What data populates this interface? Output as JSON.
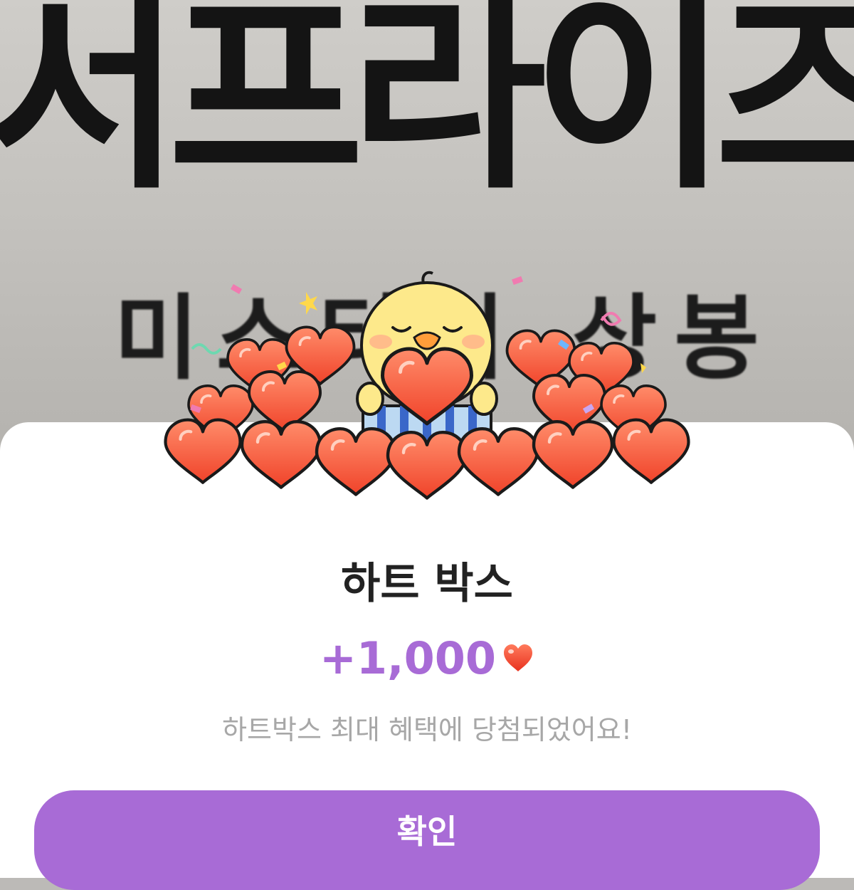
{
  "background": {
    "sign_large_text": "서프라이즈",
    "sign_small_text": "미스터리 상봉"
  },
  "colors": {
    "accent": "#a86bd6",
    "heart_red": "#f25a3c",
    "sheet": "#ffffff",
    "title": "#222222",
    "subtitle": "#a7a7a7"
  },
  "illustration": {
    "icon": "chick-holding-heart-box-icon"
  },
  "popup": {
    "title": "하트 박스",
    "amount": "+1,000",
    "amount_icon": "heart-icon",
    "message": "하트박스 최대 혜택에 당첨되었어요!",
    "confirm_label": "확인"
  }
}
